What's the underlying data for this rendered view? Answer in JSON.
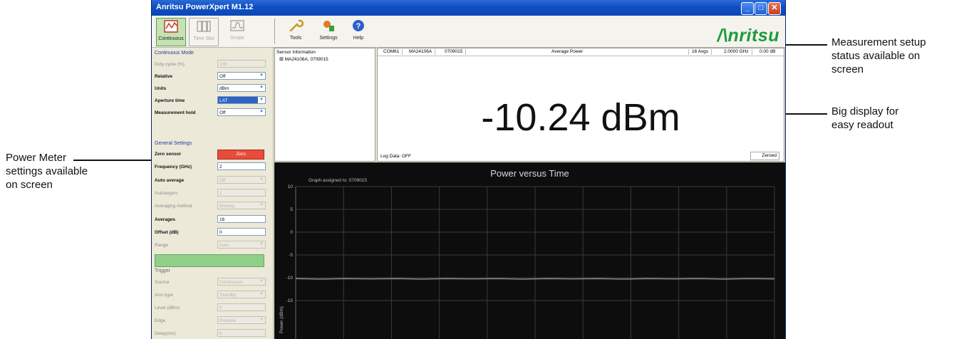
{
  "window": {
    "title": "Anritsu PowerXpert M1.12",
    "brand": "/\nritsu"
  },
  "toolbar": {
    "continuous": "Continuous",
    "time_slot": "Time Slot",
    "scope": "Scope",
    "tools": "Tools",
    "settings": "Settings",
    "help": "Help"
  },
  "continuous_mode": {
    "header": "Continuous Mode",
    "duty_cycle_label": "Duty cycle (%)",
    "duty_cycle_value": "100",
    "relative_label": "Relative",
    "relative_value": "Off",
    "units_label": "Units",
    "units_value": "dBm",
    "aperture_label": "Aperture time",
    "aperture_value": "LAT",
    "hold_label": "Measurement hold",
    "hold_value": "Off"
  },
  "general_settings": {
    "header": "General Settings",
    "zero_label": "Zero sensor",
    "zero_button": "Zero",
    "freq_label": "Frequency (GHz)",
    "freq_value": "2",
    "auto_avg_label": "Auto average",
    "auto_avg_value": "Off",
    "autoavgsrc_label": "Autoavgsrc",
    "autoavgsrc_value": "1",
    "avg_method_label": "Averaging method",
    "avg_method_value": "Moving",
    "averages_label": "Averages",
    "averages_value": "16",
    "offset_label": "Offset (dB)",
    "offset_value": "0",
    "range_label": "Range",
    "range_value": "Auto"
  },
  "trigger": {
    "header": "Trigger",
    "source_label": "Source",
    "source_value": "Continuous",
    "arm_label": "Arm type",
    "arm_value": "Standby",
    "level_label": "Level (dBm)",
    "level_value": "0",
    "edge_label": "Edge",
    "edge_value": "Positive",
    "delay_label": "Delay(ms)",
    "delay_value": "0"
  },
  "sensor_info": {
    "header": "Sensor Information",
    "item": "MA24106A, 0709015"
  },
  "readout": {
    "port": "COM61",
    "model": "MA24106A",
    "serial": "0709015",
    "mode": "Average Power",
    "avgs": "16 Avgs",
    "freq": "2.0000 GHz",
    "offset": "0.00 dB",
    "value": "-10.24 dBm",
    "log_data": "Log Data: OFF",
    "zeroed": "Zeroed"
  },
  "graph": {
    "title": "Power versus Time",
    "assigned": "Graph assigned to: 0709015",
    "ylabel": "Power (dBm)",
    "yticks": [
      "10",
      "5",
      "0",
      "-5",
      "-10",
      "-15"
    ]
  },
  "chart_data": {
    "type": "line",
    "title": "Power versus Time",
    "xlabel": "",
    "ylabel": "Power (dBm)",
    "ylim": [
      -17,
      10
    ],
    "grid": true,
    "series": [
      {
        "values": [
          -10.2,
          -10.3,
          -10.2,
          -10.25,
          -10.2,
          -10.3,
          -10.2,
          -10.25,
          -10.2,
          -10.3,
          -10.2,
          -10.25,
          -10.2,
          -10.3,
          -10.2,
          -10.25,
          -10.2,
          -10.3,
          -10.2,
          -10.25
        ]
      }
    ]
  },
  "callouts": {
    "left": "Power Meter\nsettings available\non screen",
    "top_right": "Measurement setup\nstatus available on\nscreen",
    "mid_right": "Big display for\neasy readout"
  },
  "colors": {
    "accent_green": "#1f9b3a",
    "zero_red": "#ea4c3a",
    "trace": "#8a8a8a"
  }
}
